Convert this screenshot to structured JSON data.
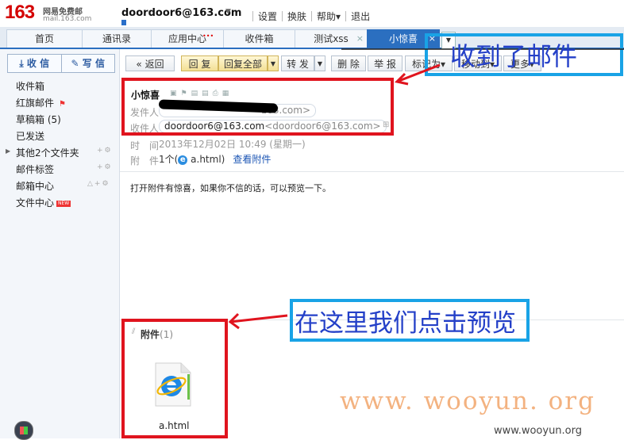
{
  "topbar": {
    "logo": "163",
    "logo_sub1": "网易免费邮",
    "logo_sub2": "mail.163.com",
    "account": "doordoor6@163.com",
    "links": [
      "设置",
      "换肤",
      "帮助▾",
      "退出"
    ]
  },
  "tabs": [
    "首页",
    "通讯录",
    "应用中心",
    "收件箱",
    "测试xss",
    "小惊喜"
  ],
  "sidebar": {
    "receive": "收 信",
    "compose": "写 信",
    "items": [
      "收件箱",
      "红旗邮件",
      "草稿箱 (5)",
      "已发送",
      "其他2个文件夹",
      "邮件标签",
      "邮箱中心",
      "文件中心"
    ],
    "new_badge": "NEW"
  },
  "toolbar": {
    "back": "返回",
    "reply": "回 复",
    "reply_all": "回复全部",
    "forward": "转 发",
    "delete": "删 除",
    "report": "举 报",
    "mark_as": "标记为",
    "move_to": "移动到",
    "more": "更多"
  },
  "message": {
    "subject": "小惊喜",
    "from_label": "发件人",
    "from_suffix": "163.com>",
    "to_label": "收件人",
    "to_name": "doordoor6@163.com",
    "to_email": "<doordoor6@163.com>",
    "time_label": "时　间",
    "time_value": "2013年12月02日 10:49 (星期一)",
    "attach_label": "附　件",
    "attach_value": "1个(",
    "attach_file_short": "a.html",
    "attach_close": ")",
    "view_attach": "查看附件",
    "body": "打开附件有惊喜，如果你不信的话，可以预览一下。"
  },
  "attachments": {
    "title": "附件",
    "count": "(1)",
    "file": "a.html"
  },
  "annotations": {
    "received": "收到了邮件",
    "click_preview": "在这里我们点击预览",
    "box_red": "#e0141e",
    "box_blue": "#19a3e6"
  },
  "watermark": {
    "big": "www. wooyun. org",
    "small": "www.wooyun.org"
  }
}
